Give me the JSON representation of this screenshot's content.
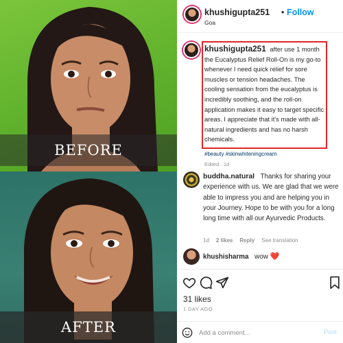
{
  "left_panel": {
    "before_label": "BEFORE",
    "after_label": "AFTER"
  },
  "header": {
    "username": "khushigupta251",
    "separator": "•",
    "follow_label": "Follow",
    "location": "Goa"
  },
  "caption": {
    "username": "khushigupta251",
    "text": "after use 1 month the Eucalyptus Relief Roll-On is my go-to whenever I need quick relief for sore muscles or tension headaches. The cooling sensation from the eucalyptus is incredibly soothing, and the roll-on application makes it easy to target specific areas. I appreciate that it's made with all-natural ingredients and has no harsh chemicals.",
    "hashtags": "#beauty #skinwhiteningcream",
    "edited": "Edited · 1d"
  },
  "comments": [
    {
      "username": "buddha.natural",
      "text": "Thanks for sharing your experience with us. We are glad that we were able to impress you and are helping you in your Journey. Hope to be with you for a long long time with all our Ayurvedic Products.",
      "time": "1d",
      "likes": "2 likes",
      "reply": "Reply",
      "translation": "See translation"
    },
    {
      "username": "khushisharma",
      "text": "wow",
      "emoji": "❤️"
    }
  ],
  "actions": {
    "icons": [
      "heart-icon",
      "comment-icon",
      "share-icon",
      "bookmark-icon"
    ],
    "likes": "31 likes",
    "time_ago": "1 DAY AGO"
  },
  "add_comment": {
    "placeholder": "Add a comment...",
    "post_label": "Post"
  },
  "colors": {
    "follow_blue": "#0095f6",
    "highlight_red": "#e02525",
    "before_bg": "#5fb12c",
    "after_bg": "#3a8073"
  }
}
